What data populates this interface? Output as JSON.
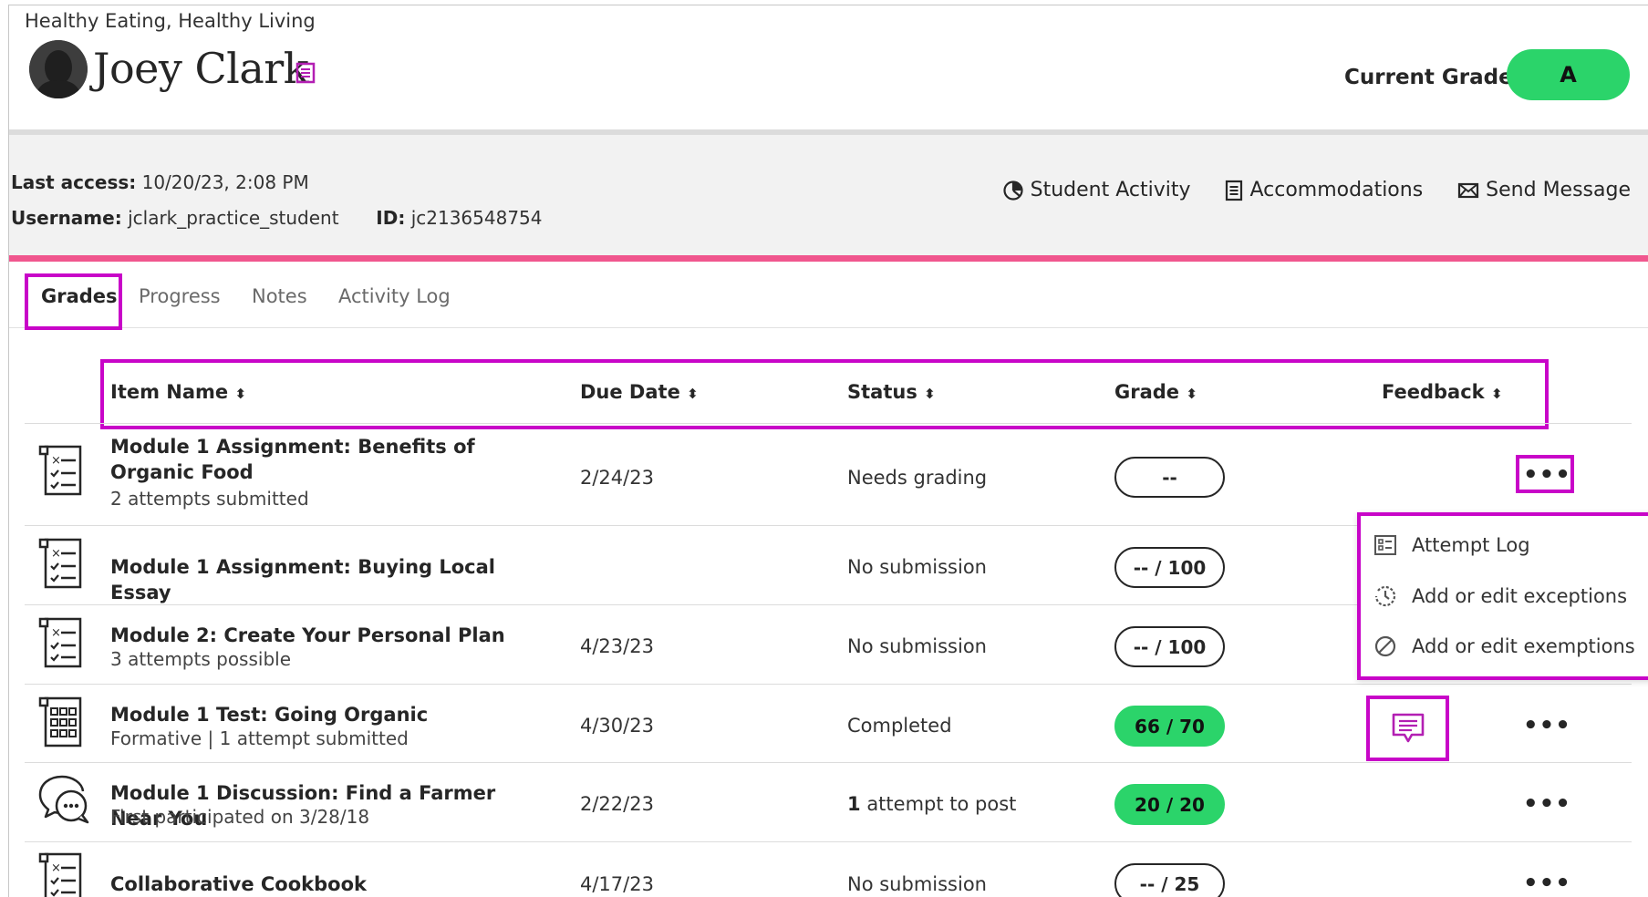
{
  "header": {
    "course": "Healthy Eating, Healthy Living",
    "student_name": "Joey Clark",
    "current_grade_label": "Current Grade",
    "current_grade": "A"
  },
  "info": {
    "last_access_label": "Last access:",
    "last_access": "10/20/23, 2:08 PM",
    "username_label": "Username:",
    "username": "jclark_practice_student",
    "id_label": "ID:",
    "id": "jc2136548754",
    "actions": [
      "Student Activity",
      "Accommodations",
      "Send Message"
    ]
  },
  "tabs": [
    "Grades",
    "Progress",
    "Notes",
    "Activity Log"
  ],
  "columns": [
    "Item Name",
    "Due Date",
    "Status",
    "Grade",
    "Feedback"
  ],
  "rows": [
    {
      "name": "Module 1 Assignment: Benefits of Organic Food",
      "sub": "2 attempts submitted",
      "due": "2/24/23",
      "status": "Needs grading",
      "grade": "--"
    },
    {
      "name": "Module 1 Assignment: Buying Local Essay",
      "sub": "",
      "due": "",
      "status": "No submission",
      "grade": "-- / 100"
    },
    {
      "name": "Module 2: Create Your Personal Plan",
      "sub": "3 attempts possible",
      "due": "4/23/23",
      "status": "No submission",
      "grade": "-- / 100"
    },
    {
      "name": "Module 1 Test: Going Organic",
      "sub": "Formative | 1 attempt submitted",
      "due": "4/30/23",
      "status": "Completed",
      "grade": "66 / 70"
    },
    {
      "name": "Module 1 Discussion: Find a Farmer Near You",
      "sub": "First participated on 3/28/18",
      "due": "2/22/23",
      "status_bold": "1",
      "status": "attempt to post",
      "grade": "20 / 20"
    },
    {
      "name": "Collaborative Cookbook",
      "sub": "",
      "due": "4/17/23",
      "status": "No submission",
      "grade": "-- / 25"
    }
  ],
  "menu": [
    "Attempt Log",
    "Add or edit exceptions",
    "Add or edit exemptions"
  ],
  "more_glyph": "•••",
  "sort_glyph": "⬍",
  "colors": {
    "accent": "#c805c8",
    "grade_green": "#2bd46a",
    "divider_pink": "#f0568e"
  }
}
